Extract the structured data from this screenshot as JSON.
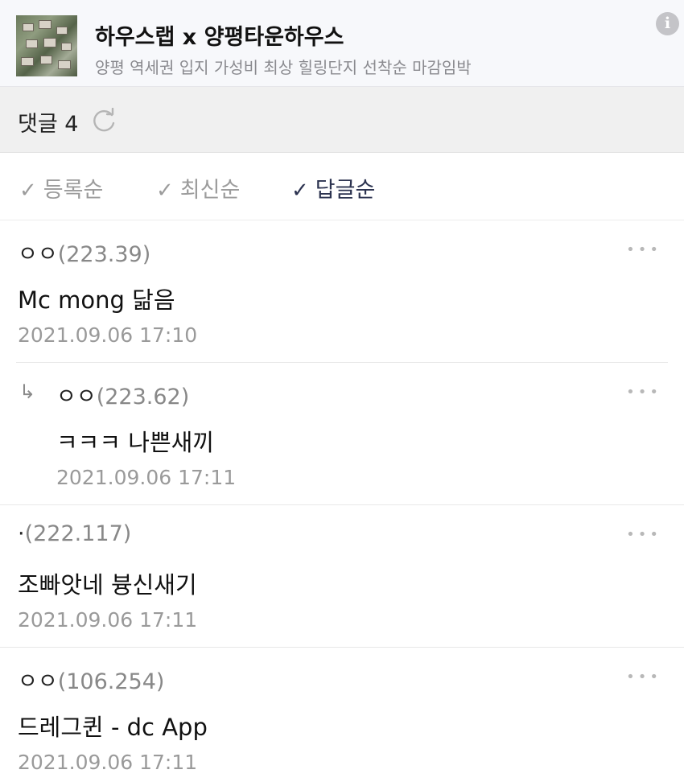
{
  "ad": {
    "title": "하우스랩 x 양평타운하우스",
    "subtitle": "양평 역세권 입지 가성비 최상 힐링단지 선착순 마감임박",
    "info_glyph": "i"
  },
  "header": {
    "comment_count_label": "댓글 4"
  },
  "sort": {
    "items": [
      {
        "label": "등록순",
        "active": false
      },
      {
        "label": "최신순",
        "active": false
      },
      {
        "label": "답글순",
        "active": true
      }
    ]
  },
  "comments": [
    {
      "nick": "ㅇㅇ",
      "ip": "(223.39)",
      "body": "Mc mong 닮음",
      "date": "2021.09.06 17:10",
      "reply": false
    },
    {
      "nick": "ㅇㅇ",
      "ip": "(223.62)",
      "body": "ㅋㅋㅋ 나쁜새끼",
      "date": "2021.09.06 17:11",
      "reply": true
    },
    {
      "nick": "·",
      "ip": "(222.117)",
      "body": "조빠앗네 븅신새기",
      "date": "2021.09.06 17:11",
      "reply": false
    },
    {
      "nick": "ㅇㅇ",
      "ip": "(106.254)",
      "body": "드레그퀸 - dc App",
      "date": "2021.09.06 17:11",
      "reply": false
    }
  ],
  "icons": {
    "check": "✓",
    "reply_arrow": "↳",
    "more": "•••"
  },
  "colors": {
    "active_sort": "#2c3350",
    "inactive_sort": "#9c9c9c",
    "header_bg": "#f0f0f0",
    "banner_bg": "#f7f8fb"
  }
}
